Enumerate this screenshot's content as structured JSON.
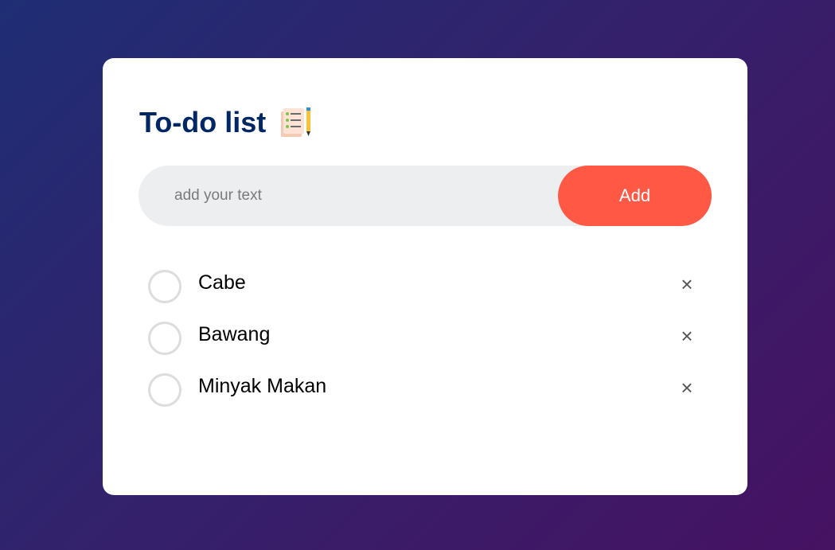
{
  "app": {
    "title": "To-do list",
    "title_icon": "notepad-pencil-icon"
  },
  "input": {
    "value": "",
    "placeholder": "add your text"
  },
  "add_button": {
    "label": "Add",
    "color": "#ff5945"
  },
  "colors": {
    "title": "#002765",
    "background_start": "#1f2e74",
    "background_end": "#461262"
  },
  "tasks": [
    {
      "text": "Cabe",
      "checked": false,
      "remove_icon": "close-icon",
      "remove_glyph": "×"
    },
    {
      "text": "Bawang",
      "checked": false,
      "remove_icon": "close-icon",
      "remove_glyph": "×"
    },
    {
      "text": "Minyak Makan",
      "checked": false,
      "remove_icon": "close-icon",
      "remove_glyph": "×"
    }
  ]
}
